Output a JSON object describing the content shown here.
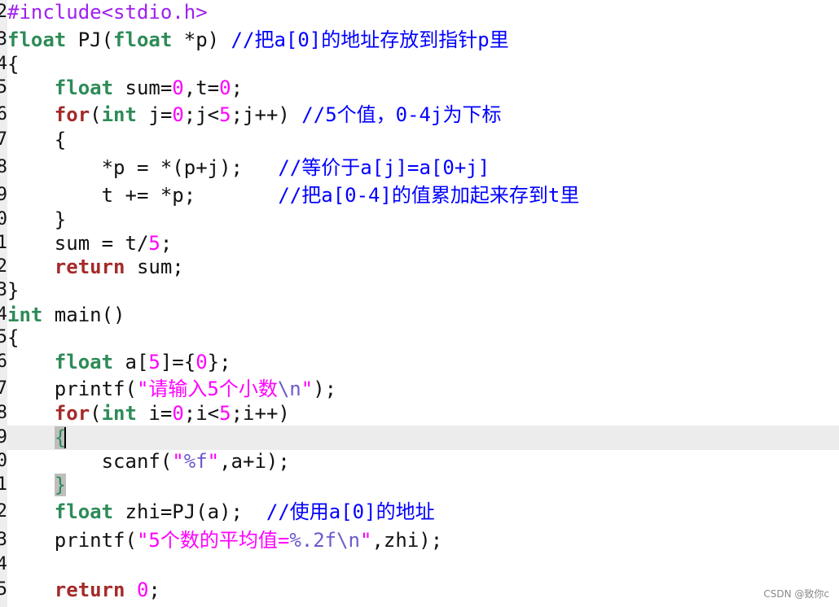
{
  "gutter": [
    "2",
    "3",
    "4",
    "5",
    "6",
    "7",
    "8",
    "9",
    "0",
    "1",
    "2",
    "3",
    "4",
    "5",
    "6",
    "7",
    "8",
    "9",
    "0",
    "1",
    "2",
    "3",
    "4",
    "5"
  ],
  "code": {
    "l1": {
      "pp": "#include<stdio.h>"
    },
    "l2": {
      "kw_a": "float",
      "t1": " PJ(",
      "kw_b": "float",
      "t2": " *p) ",
      "cm": "//把a[0]的地址存放到指针p里"
    },
    "l3": {
      "t": "{"
    },
    "l4": {
      "ind": "    ",
      "kw": "float",
      "t1": " sum=",
      "n1": "0",
      "t2": ",t=",
      "n2": "0",
      "t3": ";"
    },
    "l5": {
      "ind": "    ",
      "kw2": "for",
      "t1": "(",
      "kw": "int",
      "t2": " j=",
      "n1": "0",
      "t3": ";j<",
      "n2": "5",
      "t4": ";j++) ",
      "cm": "//5个值，0-4j为下标"
    },
    "l6": {
      "t": "    {"
    },
    "l7": {
      "t": "        *p = *(p+j);   ",
      "cm": "//等价于a[j]=a[0+j]"
    },
    "l8": {
      "t": "        t += *p;       ",
      "cm": "//把a[0-4]的值累加起来存到t里"
    },
    "l9": {
      "t": "    }"
    },
    "l10": {
      "t1": "    sum = t/",
      "n1": "5",
      "t2": ";"
    },
    "l11": {
      "ind": "    ",
      "kw2": "return",
      "t1": " sum;"
    },
    "l12": {
      "t": "}"
    },
    "l13": {
      "kw": "int",
      "t1": " main()"
    },
    "l14": {
      "t": "{"
    },
    "l15": {
      "ind": "    ",
      "kw": "float",
      "t1": " a[",
      "n1": "5",
      "t2": "]={",
      "n2": "0",
      "t3": "};"
    },
    "l16": {
      "t1": "    printf(",
      "s1": "\"请输入5个小数",
      "esc": "\\n",
      "s2": "\"",
      "t2": ");"
    },
    "l17": {
      "ind": "    ",
      "kw2": "for",
      "t1": "(",
      "kw": "int",
      "t2": " i=",
      "n1": "0",
      "t3": ";i<",
      "n2": "5",
      "t4": ";i++)"
    },
    "l18": {
      "ind": "    ",
      "brk": "{"
    },
    "l19": {
      "t1": "        scanf(",
      "s1": "\"",
      "esc": "%f",
      "s2": "\"",
      "t2": ",a+i);"
    },
    "l20": {
      "ind": "    ",
      "brk": "}"
    },
    "l21": {
      "ind": "    ",
      "kw": "float",
      "t1": " zhi=PJ(a);  ",
      "cm": "//使用a[0]的地址"
    },
    "l22": {
      "t1": "    printf(",
      "s1": "\"5个数的平均值=",
      "esc1": "%.2f",
      "esc2": "\\n",
      "s2": "\"",
      "t2": ",zhi);"
    },
    "l23": {
      "t": ""
    },
    "l24": {
      "ind": "    ",
      "kw2": "return",
      "t1": " ",
      "n1": "0",
      "t2": ";"
    }
  },
  "watermark": "CSDN @致你c",
  "colors": {
    "type_keyword": "#2e8b57",
    "control_keyword": "#a52a2a",
    "preprocessor": "#a020f0",
    "number_string": "#ff00ff",
    "escape": "#6a5acd",
    "comment": "#0000ff",
    "current_line": "#ececec"
  }
}
